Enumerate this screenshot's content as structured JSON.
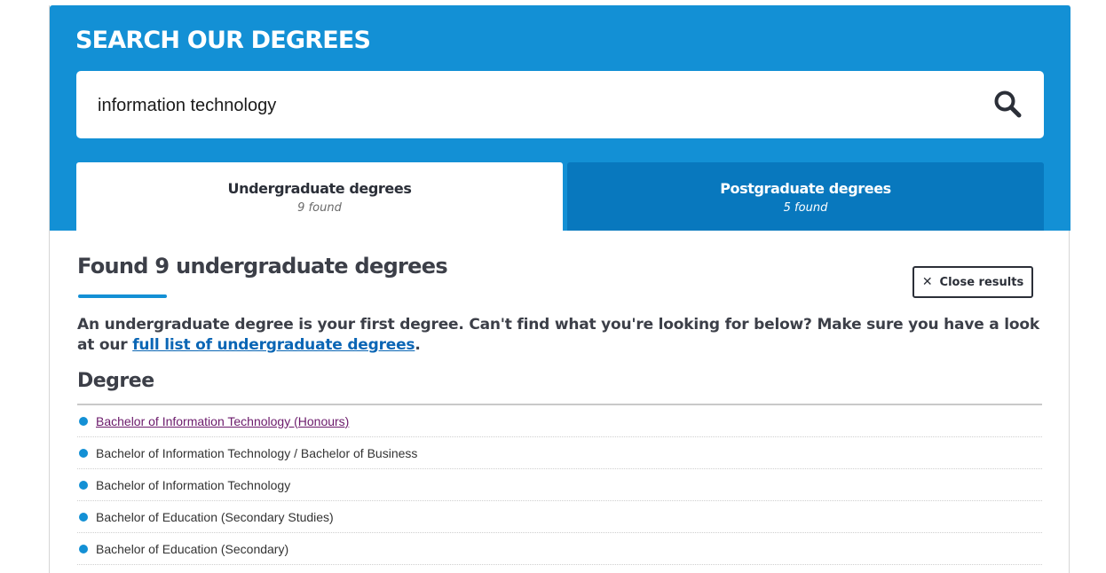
{
  "header": {
    "title": "SEARCH OUR DEGREES",
    "search_value": "information technology"
  },
  "tabs": [
    {
      "label": "Undergraduate degrees",
      "count": "9 found",
      "active": true
    },
    {
      "label": "Postgraduate degrees",
      "count": "5 found",
      "active": false
    }
  ],
  "results": {
    "heading": "Found 9 undergraduate degrees",
    "close_label": "Close results",
    "intro_text": "An undergraduate degree is your first degree. Can't find what you're looking for below? Make sure you have a look at our ",
    "intro_link": "full list of undergraduate degrees",
    "intro_end": ".",
    "list_heading": "Degree",
    "degrees": [
      "Bachelor of Information Technology (Honours)",
      "Bachelor of Information Technology / Bachelor of Business",
      "Bachelor of Information Technology",
      "Bachelor of Education (Secondary Studies)",
      "Bachelor of Education (Secondary)"
    ]
  },
  "colors": {
    "header_bg": "#1390d5",
    "inactive_tab_bg": "#0878be",
    "link": "#0b66b5",
    "visited_link": "#6b1a6b"
  },
  "icons": {
    "search": "search-icon",
    "close": "close-icon",
    "bullet": "bullet-icon"
  }
}
